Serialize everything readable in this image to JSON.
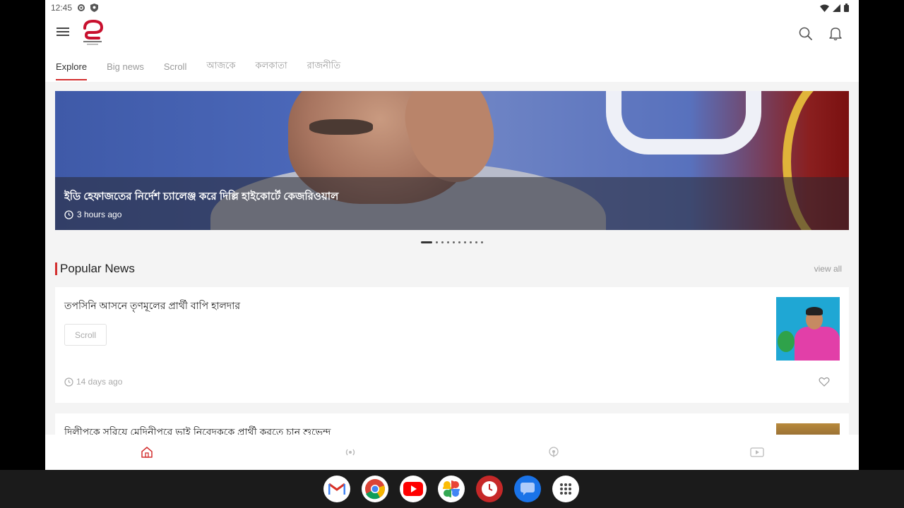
{
  "status_bar": {
    "time": "12:45"
  },
  "tabs": [
    "Explore",
    "Big news",
    "Scroll",
    "আজকে",
    "কলকাতা",
    "রাজনীতি"
  ],
  "hero": {
    "title": "ইডি হেফাজতের নির্দেশ চ্যালেঞ্জ করে দিল্লি হাইকোর্টে কেজরিওয়াল",
    "time": "3 hours ago",
    "slide_count": 10,
    "active_slide": 0
  },
  "popular": {
    "title": "Popular News",
    "view_all": "view all",
    "articles": [
      {
        "title": "তপসিনি আসনে তৃণমূলের প্রার্থী বাপি হালদার",
        "tag": "Scroll",
        "time": "14 days ago"
      },
      {
        "title": "দিলীপকে সরিয়ে মেদিনীপুরে ভাই নিবেদককে প্রার্থী করতে চান শুভেন্দু"
      }
    ]
  },
  "bottom_nav": [
    {
      "icon": "home-icon",
      "active": true
    },
    {
      "icon": "broadcast-icon",
      "active": false
    },
    {
      "icon": "podcast-icon",
      "active": false
    },
    {
      "icon": "video-icon",
      "active": false
    }
  ],
  "dock_apps": [
    "gmail-icon",
    "chrome-icon",
    "youtube-icon",
    "photos-icon",
    "clock-icon",
    "messages-icon",
    "app-drawer-icon"
  ],
  "colors": {
    "accent": "#d32f2f"
  }
}
